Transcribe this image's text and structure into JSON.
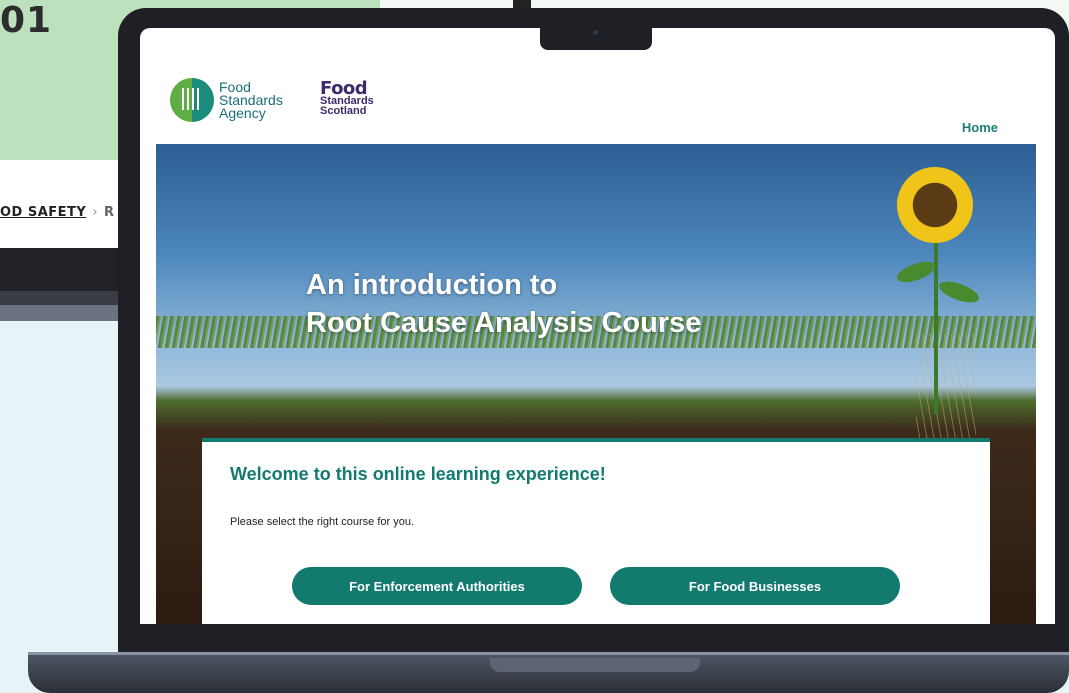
{
  "background": {
    "number": "01",
    "breadcrumb_underlined": "OD SAFETY",
    "breadcrumb_separator": "›",
    "breadcrumb_rest": "R"
  },
  "logos": {
    "fsa": [
      "Food",
      "Standards",
      "Agency"
    ],
    "fss_big": "Food",
    "fss_small": [
      "Standards",
      "Scotland"
    ]
  },
  "nav": {
    "home": "Home"
  },
  "hero": {
    "title_line1": "An introduction to",
    "title_line2": "Root Cause Analysis Course"
  },
  "welcome": {
    "heading": "Welcome to this online learning experience!",
    "subtext": "Please select the right course for you.",
    "buttons": {
      "enforcement": "For Enforcement Authorities",
      "business": "For Food Businesses"
    }
  },
  "colors": {
    "accent": "#137a70",
    "fss_purple": "#3d2a6b",
    "bg_green": "#bde0bd"
  }
}
